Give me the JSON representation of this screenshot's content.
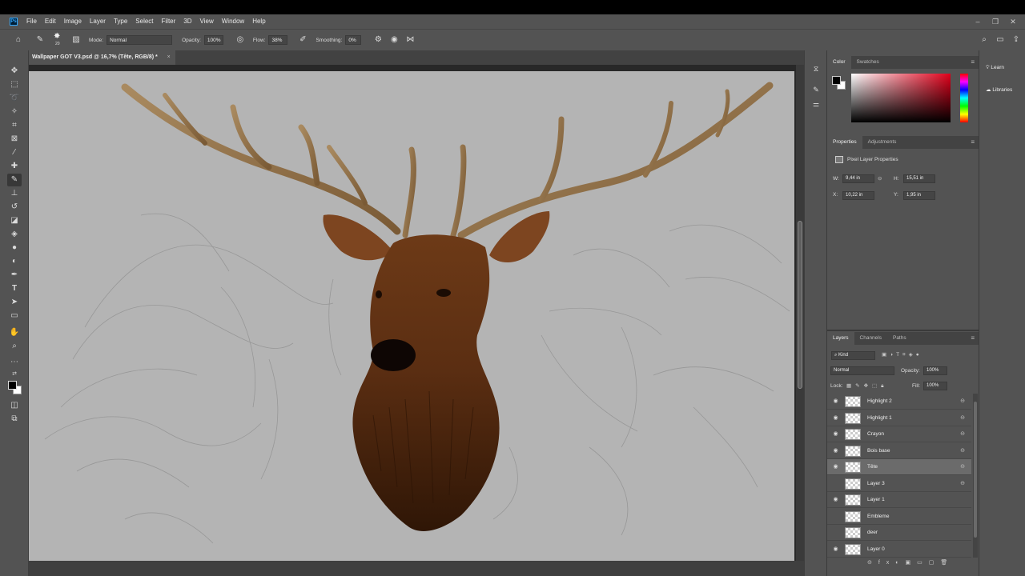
{
  "app": {
    "icon_label": "Ps"
  },
  "menu": {
    "items": [
      "File",
      "Edit",
      "Image",
      "Layer",
      "Type",
      "Select",
      "Filter",
      "3D",
      "View",
      "Window",
      "Help"
    ]
  },
  "window_controls": {
    "minimize": "–",
    "restore": "❐",
    "close": "✕"
  },
  "options": {
    "mode_label": "Mode:",
    "mode_value": "Normal",
    "opacity_label": "Opacity:",
    "opacity_value": "100%",
    "flow_label": "Flow:",
    "flow_value": "38%",
    "smoothing_label": "Smoothing:",
    "smoothing_value": "0%",
    "brush_size": "20"
  },
  "document": {
    "tab_title": "Wallpaper GOT V3.psd @ 16,7% (Tête, RGB/8) *",
    "close": "×"
  },
  "color_panel": {
    "tabs": [
      "Color",
      "Swatches"
    ]
  },
  "properties_panel": {
    "tabs": [
      "Properties",
      "Adjustments"
    ],
    "title": "Pixel Layer Properties",
    "w_label": "W:",
    "w_value": "9,44 in",
    "h_label": "H:",
    "h_value": "15,51 in",
    "x_label": "X:",
    "x_value": "10,22 in",
    "y_label": "Y:",
    "y_value": "1,95 in"
  },
  "layers_panel": {
    "tabs": [
      "Layers",
      "Channels",
      "Paths"
    ],
    "kind_label": "Kind",
    "blend_mode": "Normal",
    "opacity_label": "Opacity:",
    "opacity_value": "100%",
    "lock_label": "Lock:",
    "fill_label": "Fill:",
    "fill_value": "100%",
    "layers": [
      {
        "name": "Highlight 2",
        "visible": true,
        "selected": false,
        "linked": true
      },
      {
        "name": "Highlight 1",
        "visible": true,
        "selected": false,
        "linked": true
      },
      {
        "name": "Crayon",
        "visible": true,
        "selected": false,
        "linked": true
      },
      {
        "name": "Bois base",
        "visible": true,
        "selected": false,
        "linked": true
      },
      {
        "name": "Tête",
        "visible": true,
        "selected": true,
        "linked": true
      },
      {
        "name": "Layer 3",
        "visible": false,
        "selected": false,
        "linked": true
      },
      {
        "name": "Layer 1",
        "visible": true,
        "selected": false,
        "linked": false
      },
      {
        "name": "Embleme",
        "visible": false,
        "selected": false,
        "linked": false
      },
      {
        "name": "deer",
        "visible": false,
        "selected": false,
        "linked": false
      },
      {
        "name": "Layer 0",
        "visible": true,
        "selected": false,
        "linked": false
      }
    ]
  },
  "side_panels": {
    "learn": "Learn",
    "libraries": "Libraries"
  },
  "colors": {
    "ui_bg": "#535353",
    "canvas_bg": "#b4b4b4",
    "accent": "#31a8ff",
    "foreground_swatch": "#000000",
    "background_swatch": "#ffffff"
  }
}
